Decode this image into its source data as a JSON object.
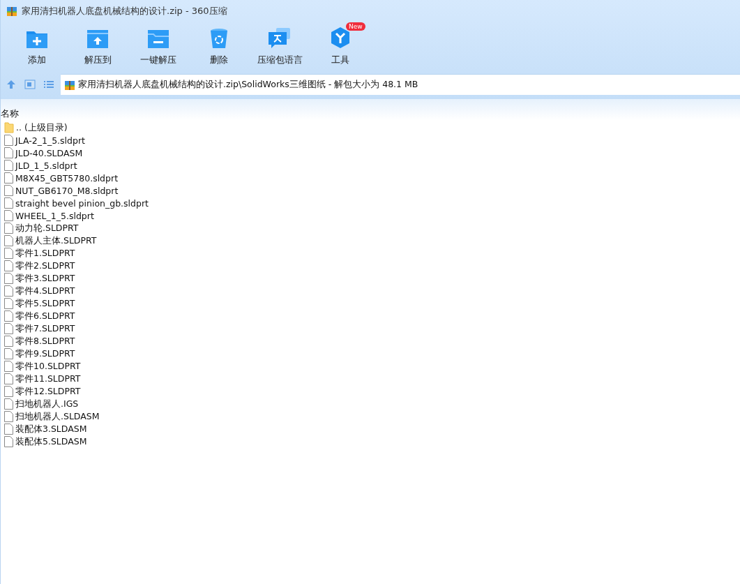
{
  "window": {
    "title": "家用清扫机器人底盘机械结构的设计.zip - 360压缩"
  },
  "toolbar": [
    {
      "kind": "add",
      "label": "添加"
    },
    {
      "kind": "extract",
      "label": "解压到"
    },
    {
      "kind": "oneclick",
      "label": "一键解压"
    },
    {
      "kind": "delete",
      "label": "删除"
    },
    {
      "kind": "language",
      "label": "压缩包语言"
    },
    {
      "kind": "tools",
      "label": "工具",
      "badge": "New"
    }
  ],
  "address": {
    "path": "家用清扫机器人底盘机械结构的设计.zip\\SolidWorks三维图纸 - 解包大小为 48.1 MB"
  },
  "table": {
    "columns": [
      "名称"
    ],
    "rows": [
      {
        "kind": "folder",
        "name": ".. (上级目录)"
      },
      {
        "kind": "file",
        "name": "JLA-2_1_5.sldprt"
      },
      {
        "kind": "file",
        "name": "JLD-40.SLDASM"
      },
      {
        "kind": "file",
        "name": "JLD_1_5.sldprt"
      },
      {
        "kind": "file",
        "name": "M8X45_GBT5780.sldprt"
      },
      {
        "kind": "file",
        "name": "NUT_GB6170_M8.sldprt"
      },
      {
        "kind": "file",
        "name": "straight bevel pinion_gb.sldprt"
      },
      {
        "kind": "file",
        "name": "WHEEL_1_5.sldprt"
      },
      {
        "kind": "file",
        "name": "动力轮.SLDPRT"
      },
      {
        "kind": "file",
        "name": "机器人主体.SLDPRT"
      },
      {
        "kind": "file",
        "name": "零件1.SLDPRT"
      },
      {
        "kind": "file",
        "name": "零件2.SLDPRT"
      },
      {
        "kind": "file",
        "name": "零件3.SLDPRT"
      },
      {
        "kind": "file",
        "name": "零件4.SLDPRT"
      },
      {
        "kind": "file",
        "name": "零件5.SLDPRT"
      },
      {
        "kind": "file",
        "name": "零件6.SLDPRT"
      },
      {
        "kind": "file",
        "name": "零件7.SLDPRT"
      },
      {
        "kind": "file",
        "name": "零件8.SLDPRT"
      },
      {
        "kind": "file",
        "name": "零件9.SLDPRT"
      },
      {
        "kind": "file",
        "name": "零件10.SLDPRT"
      },
      {
        "kind": "file",
        "name": "零件11.SLDPRT"
      },
      {
        "kind": "file",
        "name": "零件12.SLDPRT"
      },
      {
        "kind": "file",
        "name": "扫地机器人.IGS"
      },
      {
        "kind": "file",
        "name": "扫地机器人.SLDASM"
      },
      {
        "kind": "file",
        "name": "装配体3.SLDASM"
      },
      {
        "kind": "file",
        "name": "装配体5.SLDASM"
      }
    ]
  }
}
